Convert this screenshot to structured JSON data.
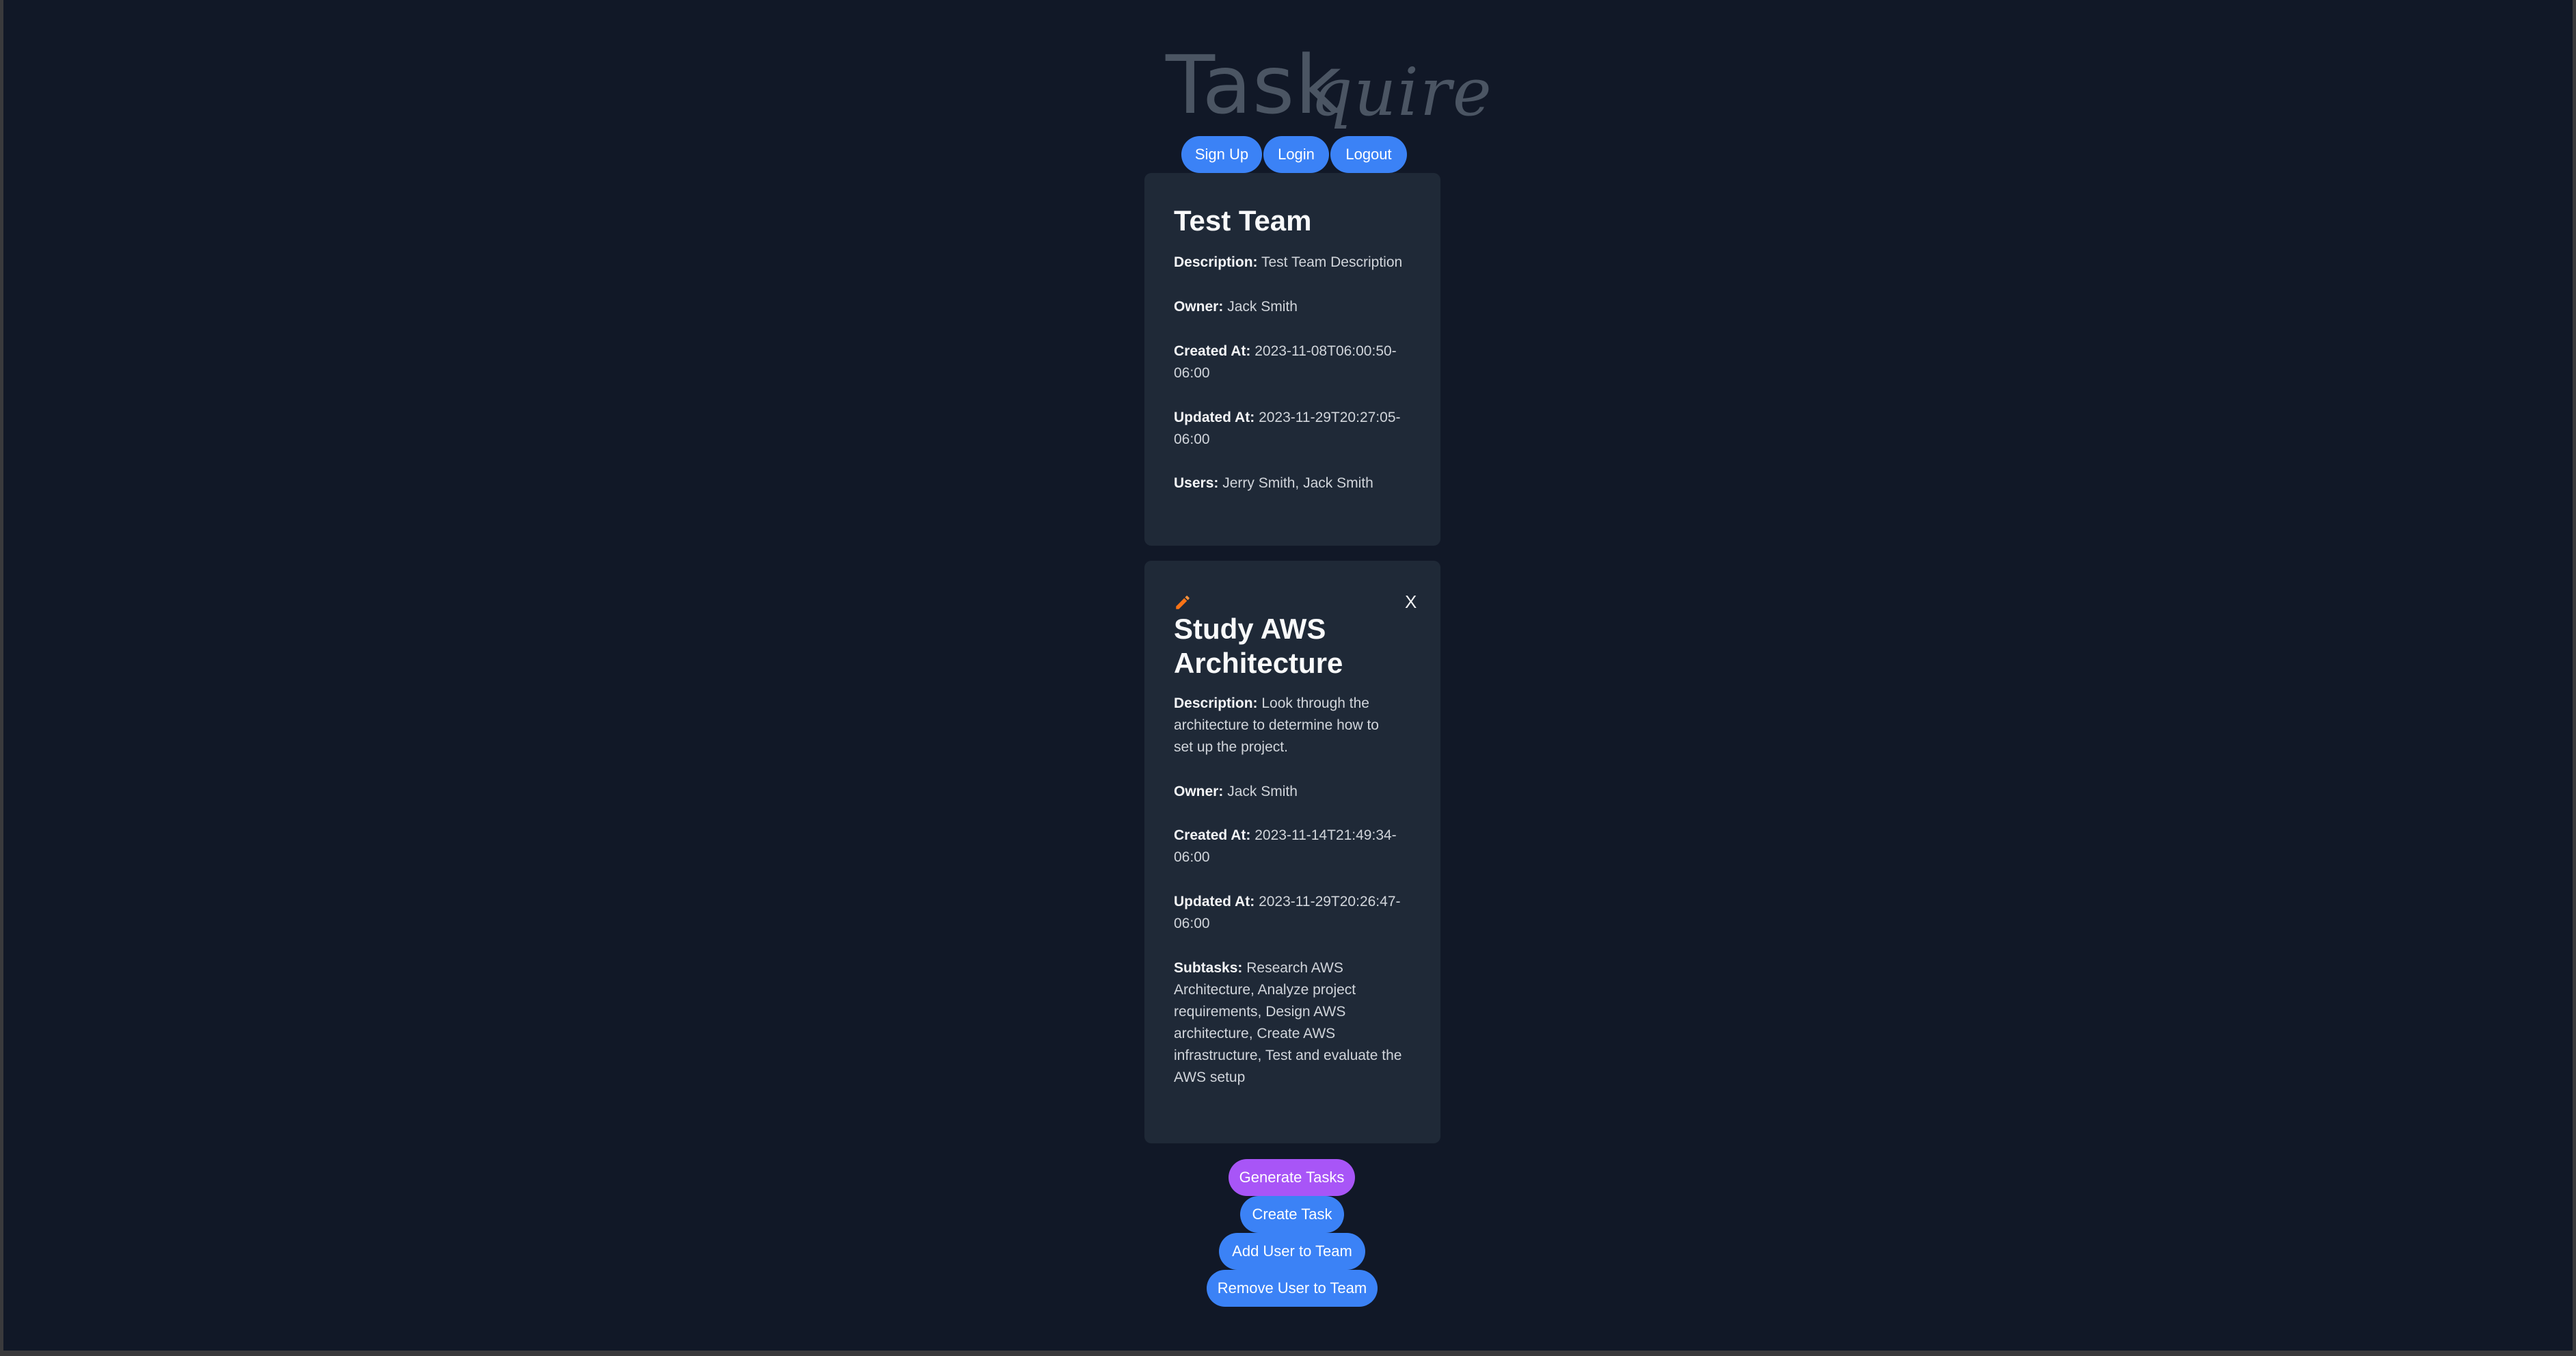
{
  "app": {
    "logo_part1": "Task",
    "logo_part2": "quire"
  },
  "nav": {
    "sign_up": "Sign Up",
    "login": "Login",
    "logout": "Logout"
  },
  "team": {
    "title": "Test Team",
    "description_label": "Description:",
    "description": "Test Team Description",
    "owner_label": "Owner:",
    "owner": "Jack Smith",
    "created_label": "Created At:",
    "created_line1": "2023-11-08T06:00:50-",
    "created_line2": "06:00",
    "updated_label": "Updated At:",
    "updated_line1": "2023-11-29T20:27:05-",
    "updated_line2": "06:00",
    "users_label": "Users:",
    "users": "Jerry Smith, Jack Smith"
  },
  "task": {
    "close": "X",
    "title_line1": "Study AWS",
    "title_line2": "Architecture",
    "description_label": "Description:",
    "description_line1": "Look through the",
    "description_line2": "architecture to determine how to",
    "description_line3": "set up the project.",
    "owner_label": "Owner:",
    "owner": "Jack Smith",
    "created_label": "Created At:",
    "created_line1": "2023-11-14T21:49:34-",
    "created_line2": "06:00",
    "updated_label": "Updated At:",
    "updated_line1": "2023-11-29T20:26:47-",
    "updated_line2": "06:00",
    "subtasks_label": "Subtasks:",
    "subtasks_line1": "Research AWS",
    "subtasks_line2": "Architecture, Analyze project",
    "subtasks_line3": "requirements, Design AWS",
    "subtasks_line4": "architecture, Create AWS",
    "subtasks_line5": "infrastructure, Test and evaluate the",
    "subtasks_line6": "AWS setup"
  },
  "actions": {
    "generate_tasks": "Generate Tasks",
    "create_task": "Create Task",
    "add_user": "Add User to Team",
    "remove_user": "Remove User to Team"
  },
  "colors": {
    "background": "#111827",
    "card": "#1f2937",
    "primary_button": "#3b82f6",
    "generate_button": "#a855f7",
    "pencil_icon": "#f97316"
  }
}
